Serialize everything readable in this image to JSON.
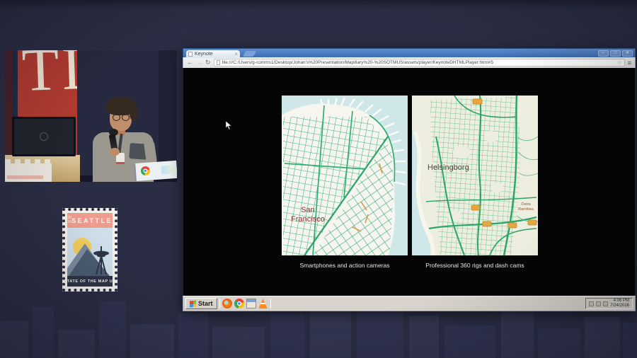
{
  "browser": {
    "tab_title": "Keynote",
    "tab_close_icon": "×",
    "window_controls": {
      "minimize": "–",
      "maximize": "□",
      "close": "✕"
    },
    "toolbar": {
      "back_icon": "←",
      "forward_icon": "→",
      "refresh_icon": "↻",
      "url": "file:///C:/Users/g-comms1/Desktop/Johan's%20Presentation/Mapillary%20-%20SOTMUS/assets/player/KeynoteDHTMLPlayer.html#5",
      "star_icon": "☆",
      "menu_icon": "≡"
    }
  },
  "slide": {
    "maps": [
      {
        "caption": "Smartphones and action cameras",
        "place_label": "San Francisco"
      },
      {
        "caption": "Professional 360 rigs and dash cams",
        "place_label": "Helsingborg",
        "secondary_label": "Östra Ramlösa"
      }
    ]
  },
  "taskbar": {
    "start_label": "Start",
    "clock_time": "4:06 PM",
    "clock_date": "7/24/2016"
  },
  "stamp": {
    "year_top": "20",
    "year_bottom": "16",
    "city": "SEATTLE",
    "footer": "STATE OF THE MAP US"
  },
  "webcam_overlay": {
    "banner_letters": "TL"
  },
  "colors": {
    "coverage_green": "#35b277",
    "map_water": "#cfe7e8",
    "titlebar_blue": "#4c7ec0",
    "banner_red": "#b23b31"
  }
}
